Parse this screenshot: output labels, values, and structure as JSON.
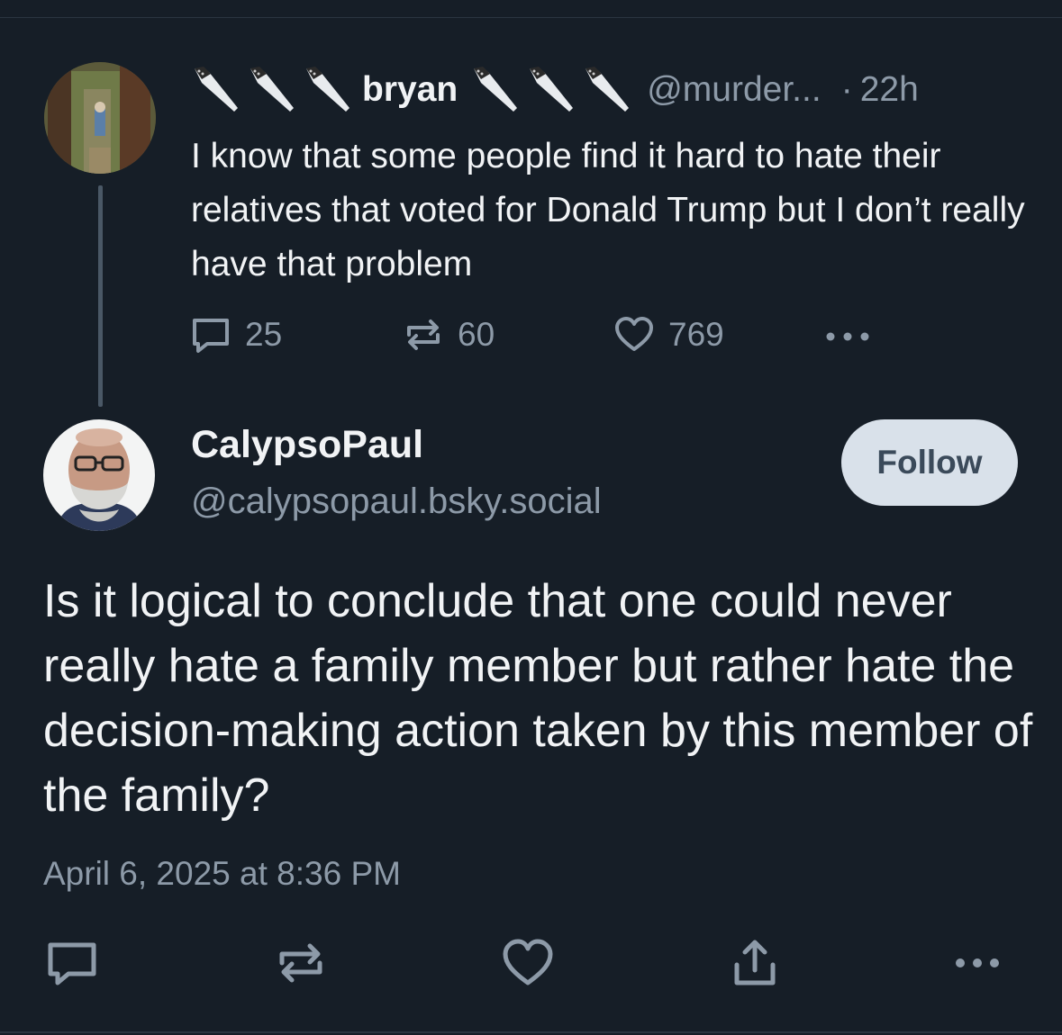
{
  "parent_post": {
    "display_name": "bryan",
    "handle": "@murder...",
    "separator": "·",
    "time_ago": "22h",
    "text": "I know that some people find it hard to hate their relatives that voted for Donald Trump but I don’t really have that problem",
    "name_icons": [
      "knife-icon",
      "knife-icon",
      "knife-icon",
      "knife-icon",
      "knife-icon",
      "knife-icon"
    ],
    "stats": {
      "replies": "25",
      "reposts": "60",
      "likes": "769"
    }
  },
  "reply_post": {
    "display_name": "CalypsoPaul",
    "handle": "@calypsopaul.bsky.social",
    "follow_label": "Follow",
    "text": "Is it logical to conclude that one could never really hate a family member but rather hate the decision-making action taken by this member of the family?",
    "timestamp": "April 6, 2025 at 8:36 PM"
  },
  "colors": {
    "background": "#161e27",
    "primary_text": "#f1f3f5",
    "secondary_text": "#8d9aa8",
    "follow_button_bg": "#d9e1ea",
    "follow_button_text": "#3b4a5a",
    "thread_line": "#4a5866"
  },
  "icons": {
    "reply": "speech-bubble-icon",
    "repost": "repost-arrows-icon",
    "like": "heart-icon",
    "share": "share-upload-icon",
    "more": "ellipsis-icon"
  }
}
